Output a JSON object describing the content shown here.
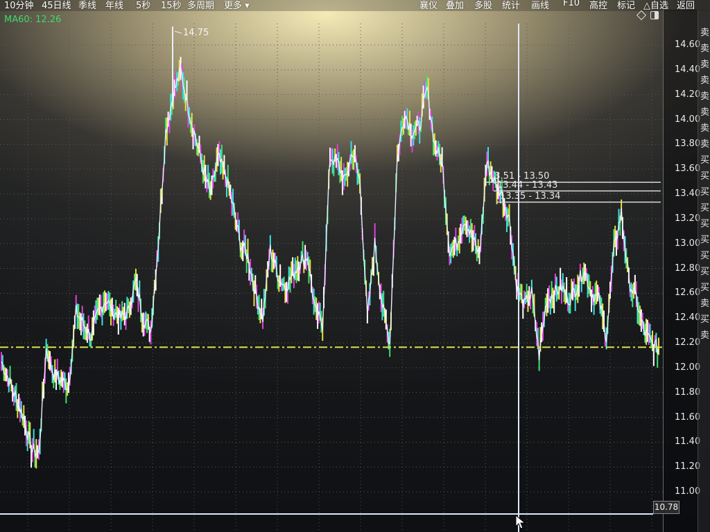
{
  "toolbar": {
    "items": [
      "10分钟",
      "45日线",
      "季线",
      "年线",
      "5秒",
      "15秒",
      "多周期",
      "更多 ▾",
      "襄仪",
      "叠加",
      "多股",
      "统计",
      "画线",
      "F10",
      "高控",
      "标记",
      "△自选",
      "返回"
    ]
  },
  "indicator": {
    "ma_label": "MA60: 12.26",
    "ma_color": "#3ddc6a"
  },
  "chart_data": {
    "type": "line",
    "yticks": [
      "14.60",
      "14.40",
      "14.20",
      "14.00",
      "13.80",
      "13.60",
      "13.40",
      "13.20",
      "13.00",
      "12.80",
      "12.60",
      "12.40",
      "12.20",
      "12.00",
      "11.80",
      "11.60",
      "11.40",
      "11.20",
      "11.00"
    ],
    "ylim": [
      10.9,
      14.75
    ],
    "high_marker": "14.75",
    "ma60_value": 12.26,
    "hover_price": "10.78",
    "levels": [
      {
        "label": "13.51 - 13.50",
        "price": 13.5
      },
      {
        "label": "13.44 - 13.43",
        "price": 13.43
      },
      {
        "label": "13.35 - 13.34",
        "price": 13.34
      }
    ],
    "series": [
      {
        "values": [
          12.05,
          11.9,
          11.75,
          11.6,
          11.35,
          11.3,
          12.15,
          11.95,
          11.9,
          11.85,
          12.45,
          12.35,
          12.25,
          12.45,
          12.55,
          12.45,
          12.4,
          12.45,
          12.7,
          12.4,
          12.3,
          13.0,
          13.9,
          14.2,
          14.4,
          14.1,
          13.85,
          13.6,
          13.4,
          13.7,
          13.55,
          13.3,
          13.0,
          12.9,
          12.6,
          12.4,
          12.95,
          12.75,
          12.65,
          12.75,
          12.85,
          12.9,
          12.45,
          12.35,
          13.7,
          13.65,
          13.5,
          13.75,
          13.5,
          12.4,
          13.0,
          12.5,
          12.2,
          13.7,
          14.05,
          13.9,
          13.95,
          14.25,
          13.8,
          13.65,
          12.95,
          13.0,
          13.2,
          13.05,
          12.9,
          13.65,
          13.5,
          13.4,
          13.2,
          12.65,
          12.5,
          12.6,
          12.1,
          12.55,
          12.6,
          12.65,
          12.55,
          12.65,
          12.8,
          12.6,
          12.55,
          12.25,
          12.95,
          13.25,
          12.7,
          12.55,
          12.3,
          12.2,
          12.15
        ]
      }
    ]
  },
  "side_strip": {
    "chars": [
      "卖",
      "卖",
      "卖",
      "卖",
      "卖",
      "卖",
      "卖",
      "卖",
      "买",
      "买",
      "买",
      "买",
      "买",
      "买",
      "买",
      "买",
      "买",
      "卖",
      "买",
      "卖"
    ]
  },
  "colors": {
    "price_line": "#e8f1ff",
    "ma_dash": "#e0e04a",
    "bar_magenta": "#e040e0",
    "bar_cyan": "#40e0e0",
    "bar_green": "#40e070",
    "bar_yellow": "#e8e040"
  },
  "icons": [
    "settings-diamond-icon",
    "window-toggle-icon",
    "mouse-cursor-icon"
  ]
}
